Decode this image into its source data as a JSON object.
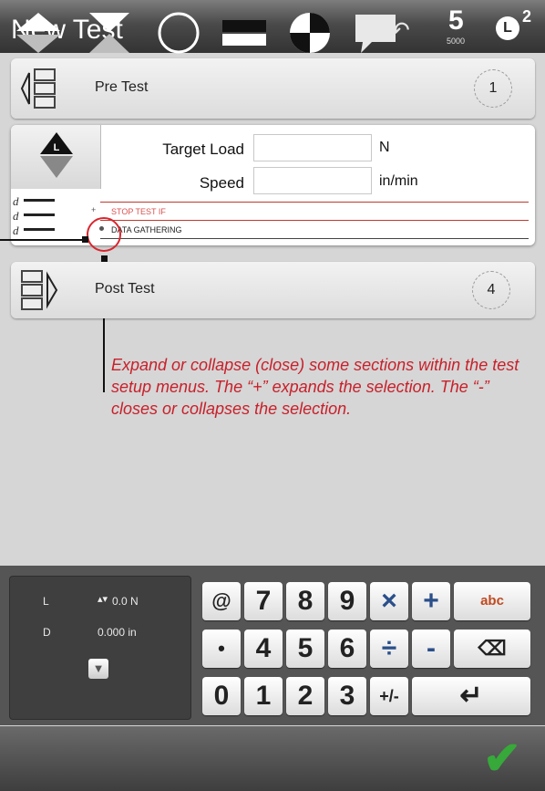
{
  "titlebar": {
    "title": "New Test",
    "speed_value": "5",
    "speed_sub": "5000",
    "load_letter": "L",
    "load_superscript": "2"
  },
  "sections": {
    "pre_test": {
      "label": "Pre Test",
      "step": "1"
    },
    "post_test": {
      "label": "Post Test",
      "step": "4"
    }
  },
  "test_setup": {
    "target_load_label": "Target Load",
    "target_load_value": "",
    "target_load_unit": "N",
    "speed_label": "Speed",
    "speed_value": "",
    "speed_unit": "in/min",
    "stop_test_if": "STOP TEST IF",
    "data_gathering": "DATA GATHERING"
  },
  "callout": {
    "text": "Expand or collapse (close) some sections within the test setup menus.  The “+” expands the selection.  The “-” closes or collapses the selection."
  },
  "readout": {
    "load_label": "L",
    "load_value": "0.0 N",
    "disp_label": "D",
    "disp_value": "0.000 in"
  },
  "keypad": {
    "row1": [
      "@",
      "7",
      "8",
      "9",
      "×",
      "+",
      "abc"
    ],
    "row2": [
      "•",
      "4",
      "5",
      "6",
      "÷",
      "-",
      "⌫"
    ],
    "row3": [
      "0",
      "1",
      "2",
      "3",
      "+/-",
      "↵"
    ]
  },
  "colors": {
    "accent_red": "#c8202a",
    "confirm_green": "#37a83a"
  }
}
